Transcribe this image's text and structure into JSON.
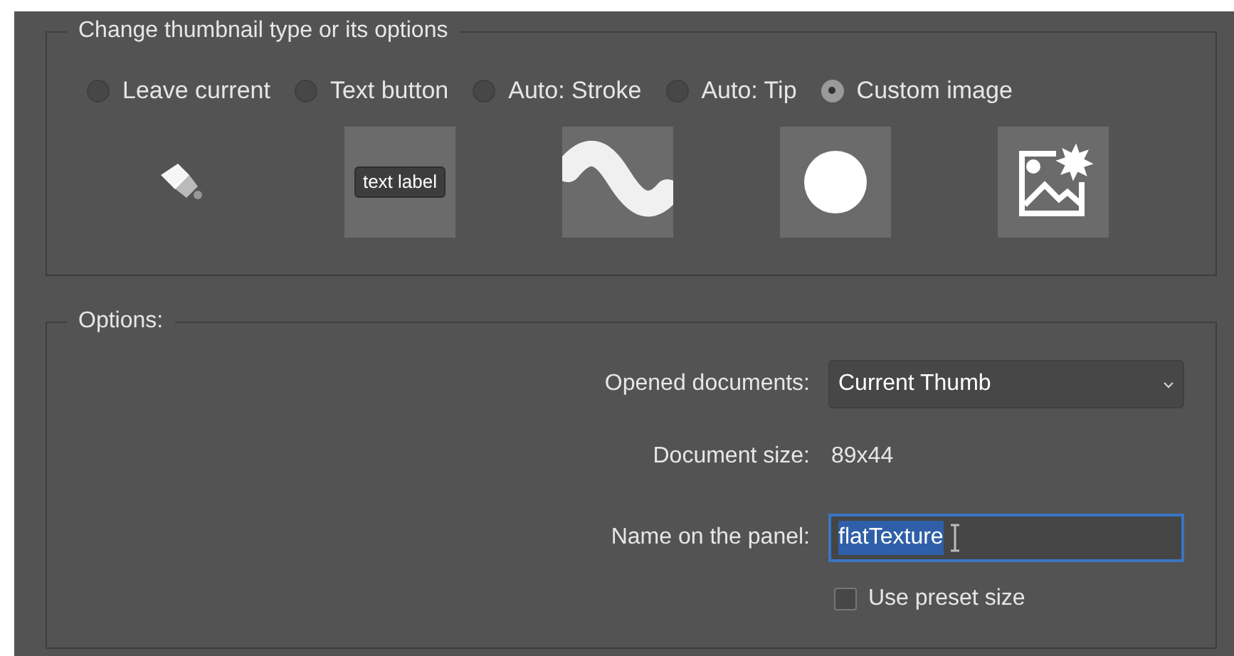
{
  "thumbnail_group": {
    "title": "Change thumbnail type or its options",
    "options": [
      {
        "label": "Leave current",
        "selected": false,
        "kind": "brush"
      },
      {
        "label": "Text button",
        "selected": false,
        "kind": "text",
        "thumb_label": "text label"
      },
      {
        "label": "Auto: Stroke",
        "selected": false,
        "kind": "wave"
      },
      {
        "label": "Auto: Tip",
        "selected": false,
        "kind": "circle"
      },
      {
        "label": "Custom image",
        "selected": true,
        "kind": "image"
      }
    ]
  },
  "options_group": {
    "title": "Options:",
    "opened_documents": {
      "label": "Opened documents:",
      "value": "Current Thumb"
    },
    "document_size": {
      "label": "Document size:",
      "value": "89x44"
    },
    "name_on_panel": {
      "label": "Name on the panel:",
      "value": "flatTexture",
      "value_selected": true
    },
    "use_preset_size": {
      "label": "Use preset size",
      "checked": false
    }
  }
}
